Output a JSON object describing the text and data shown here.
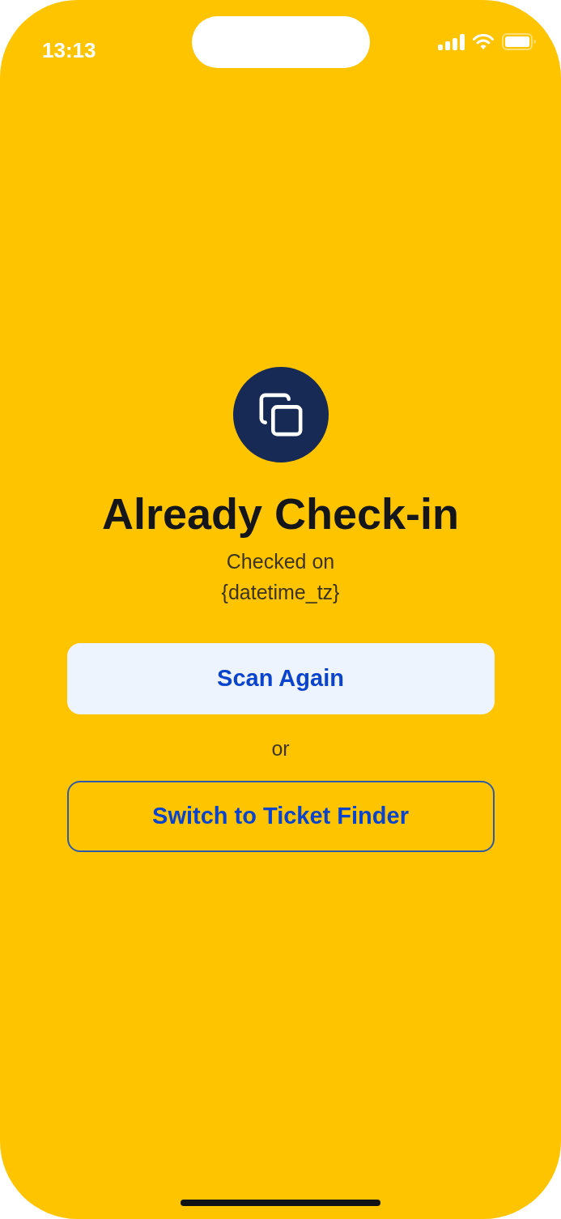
{
  "status_bar": {
    "time": "13:13"
  },
  "title": "Already Check-in",
  "checked_label": "Checked on",
  "checked_value": "{datetime_tz}",
  "actions": [
    {
      "kind": "filled",
      "label": "Scan Again"
    },
    {
      "kind": "text",
      "label": "or"
    },
    {
      "kind": "outline",
      "label": "Switch to Ticket Finder"
    }
  ]
}
